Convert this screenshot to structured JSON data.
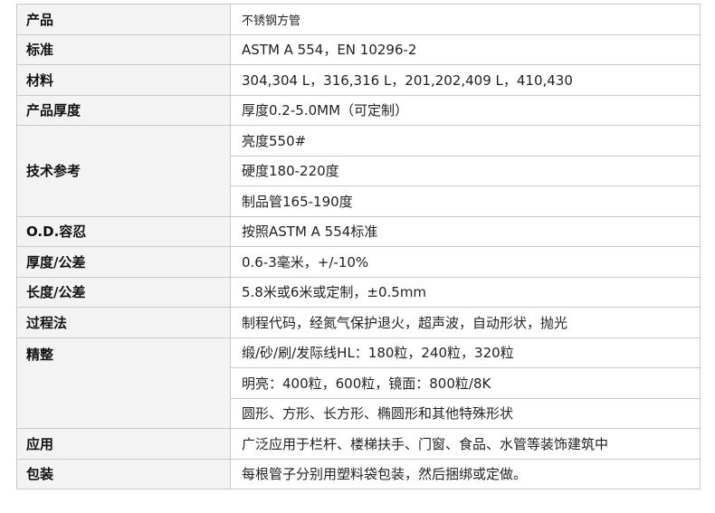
{
  "rows": [
    {
      "label": "产品",
      "values": [
        "不锈钢方管"
      ]
    },
    {
      "label": "标准",
      "values": [
        "ASTM A 554，EN 10296-2"
      ]
    },
    {
      "label": "材料",
      "values": [
        "304,304 L，316,316 L，201,202,409 L，410,430"
      ]
    },
    {
      "label": "产品厚度",
      "values": [
        "厚度0.2-5.0MM（可定制）"
      ]
    },
    {
      "label": "技术参考",
      "values": [
        "亮度550#",
        "硬度180-220度",
        "制品管165-190度"
      ]
    },
    {
      "label": "O.D.容忍",
      "values": [
        "按照ASTM A 554标准"
      ]
    },
    {
      "label": "厚度/公差",
      "values": [
        "0.6-3毫米，+/-10%"
      ]
    },
    {
      "label": "长度/公差",
      "values": [
        "5.8米或6米或定制，±0.5mm"
      ]
    },
    {
      "label": "过程法",
      "values": [
        "制程代码，经氮气保护退火，超声波，自动形状，抛光"
      ]
    },
    {
      "label": "精整",
      "values": [
        "缎/砂/刷/发际线HL：180粒，240粒，320粒",
        "明亮：400粒，600粒，镜面：800粒/8K",
        "圆形、方形、长方形、椭圆形和其他特殊形状"
      ]
    },
    {
      "label": "应用",
      "values": [
        "广泛应用于栏杆、楼梯扶手、门窗、食品、水管等装饰建筑中"
      ]
    },
    {
      "label": "包装",
      "values": [
        "每根管子分别用塑料袋包装，然后捆绑或定做。"
      ]
    }
  ]
}
